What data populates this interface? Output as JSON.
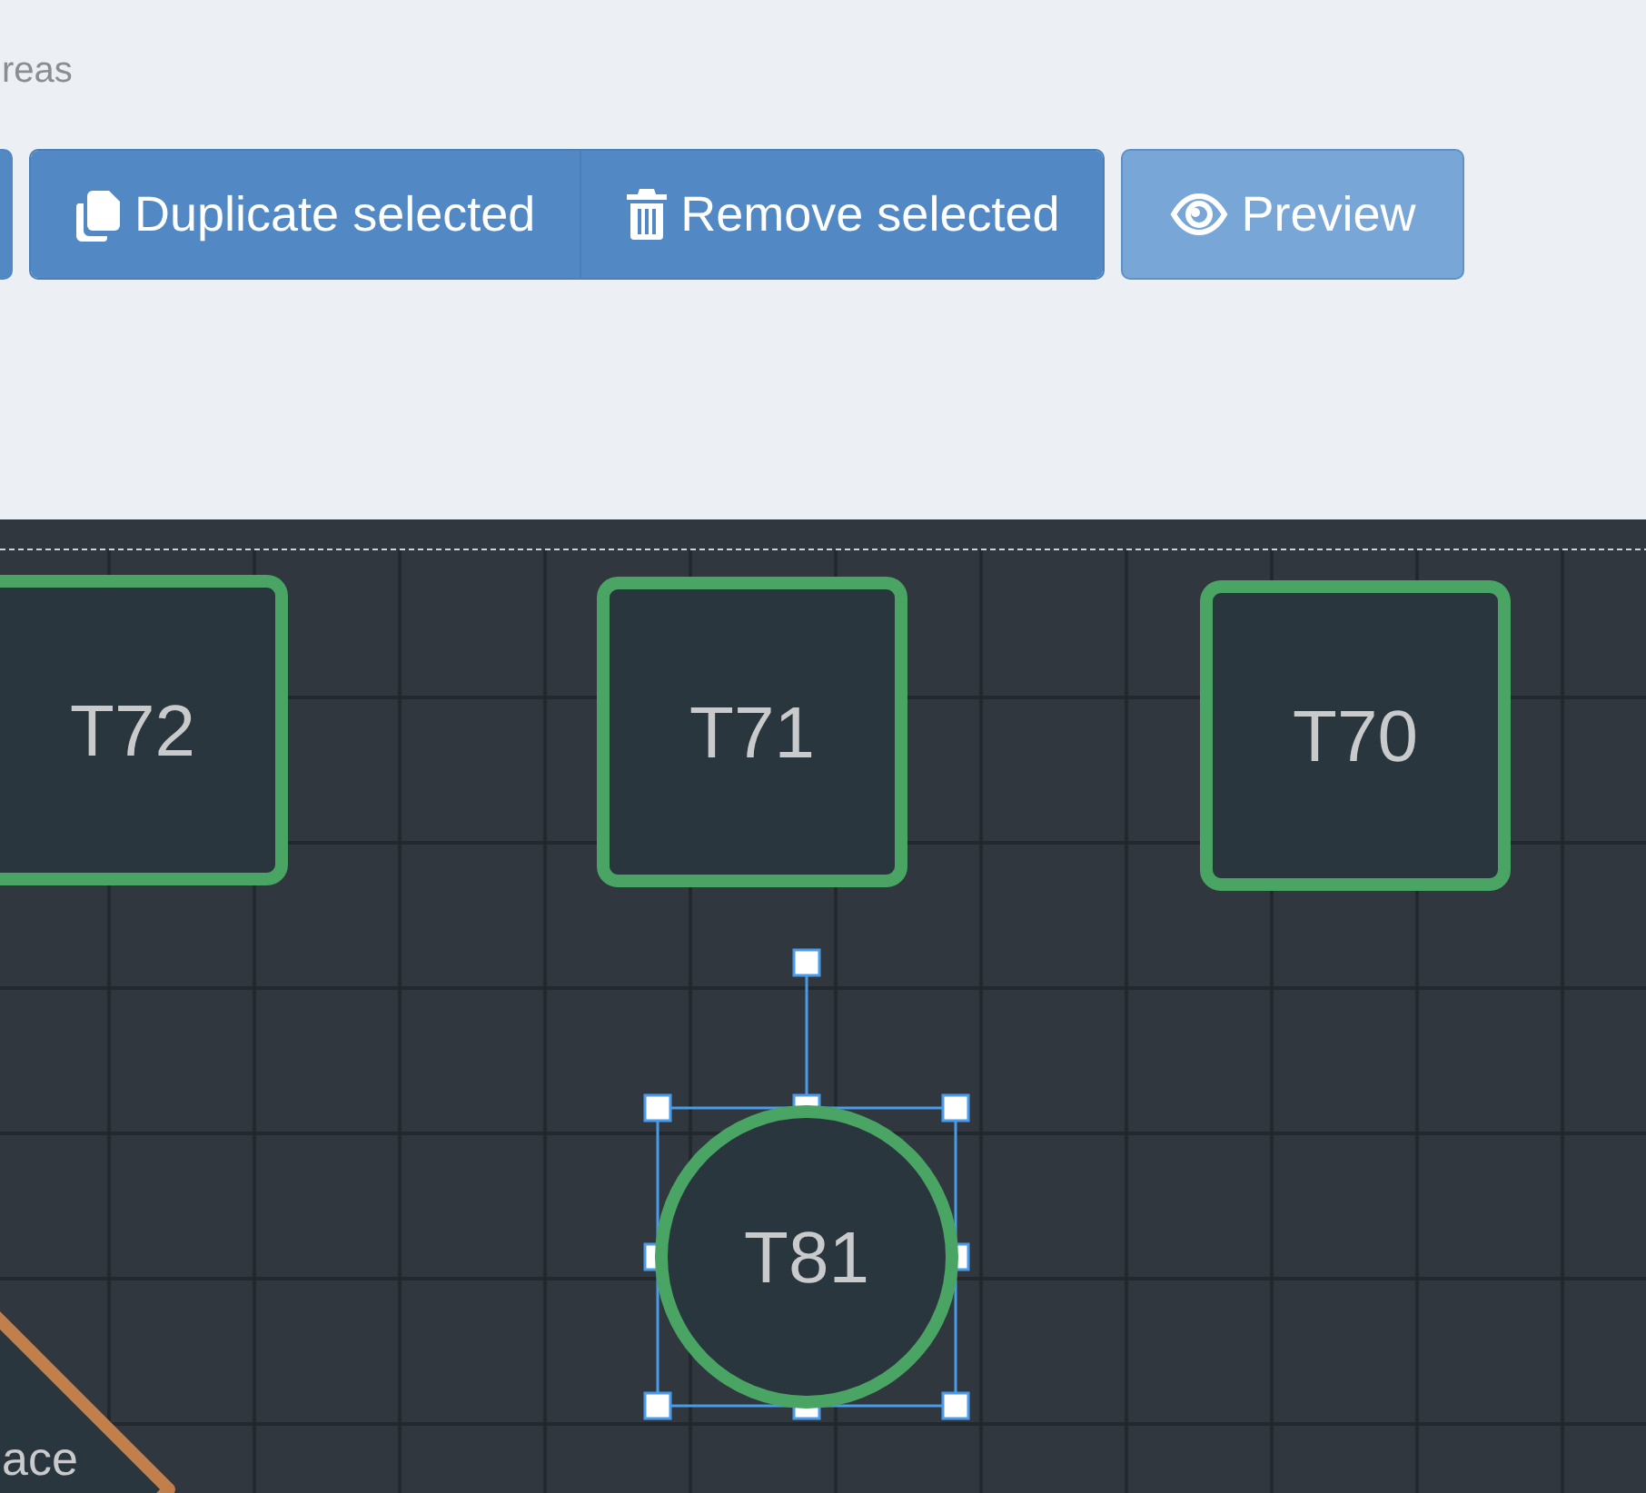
{
  "header": {
    "caption": "reas"
  },
  "buttons": [
    {
      "kind": "cut"
    },
    {
      "kind": "grouped",
      "label": "Duplicate selected",
      "disabled": false
    },
    {
      "kind": "grouped",
      "label": "Remove selected",
      "disabled": false
    },
    {
      "kind": "single",
      "label": "Preview",
      "disabled": true
    }
  ],
  "nodes": [
    {
      "kind": "square",
      "label": "T72",
      "color": "#4aa463",
      "selected": false
    },
    {
      "kind": "square",
      "label": "T71",
      "color": "#4aa463",
      "selected": false
    },
    {
      "kind": "square",
      "label": "T70",
      "color": "#4aa463",
      "selected": false
    },
    {
      "kind": "circle",
      "label": "T81",
      "color": "#4aa463",
      "selected": true
    },
    {
      "kind": "diamond",
      "label": "ace",
      "color": "#c17f4b",
      "selected": false
    }
  ]
}
